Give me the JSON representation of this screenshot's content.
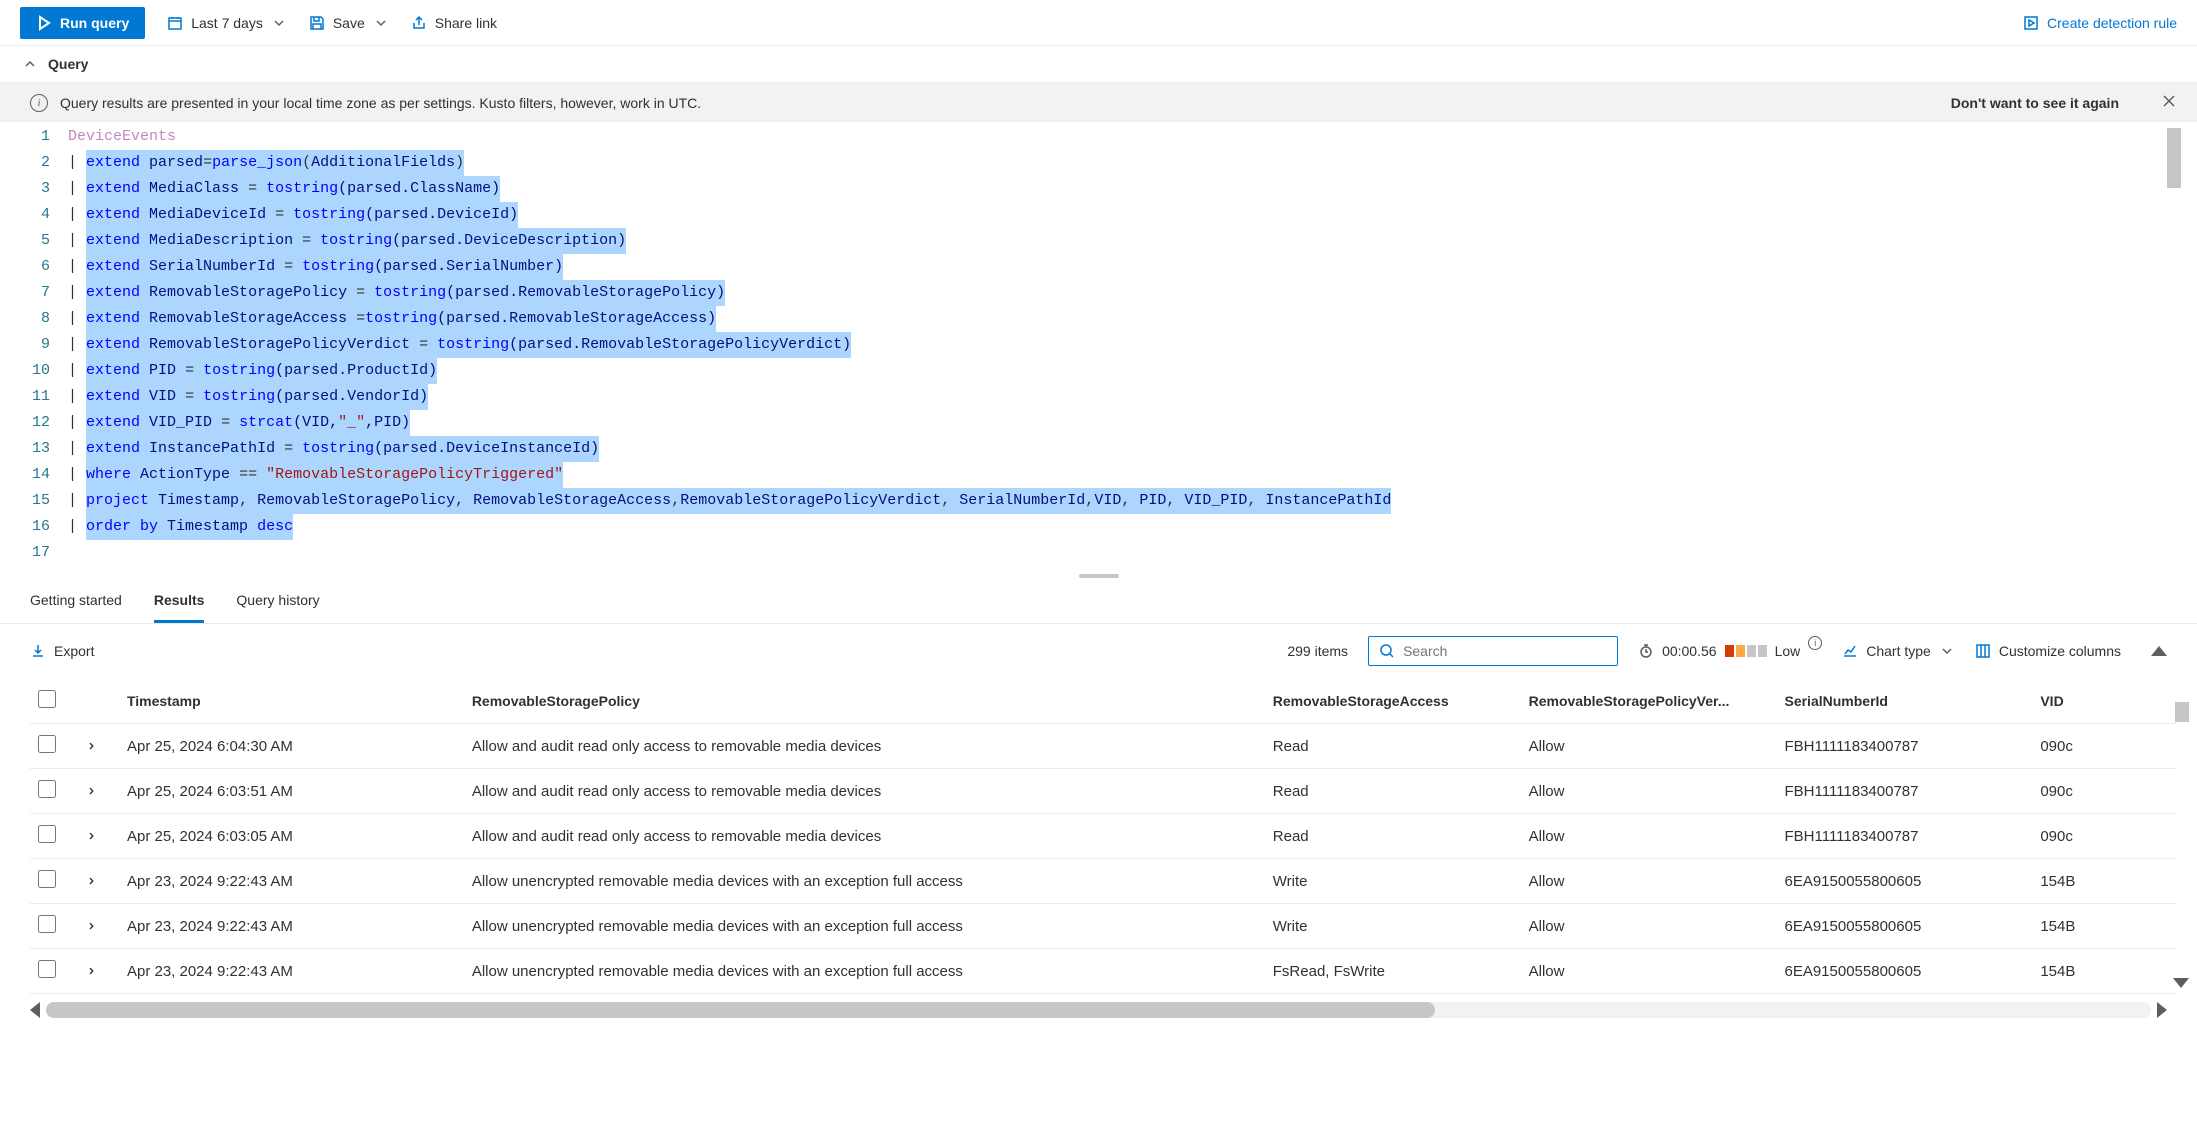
{
  "toolbar": {
    "run": "Run query",
    "timeRange": "Last 7 days",
    "save": "Save",
    "share": "Share link",
    "createRule": "Create detection rule"
  },
  "queryHeader": "Query",
  "banner": {
    "text": "Query results are presented in your local time zone as per settings. Kusto filters, however, work in UTC.",
    "dismiss": "Don't want to see it again"
  },
  "code": {
    "lineCount": 17,
    "lines": [
      [
        {
          "t": "DeviceEvents",
          "c": "tk-table"
        }
      ],
      [
        {
          "t": "| ",
          "c": "tk-pipe"
        },
        {
          "t": "extend ",
          "c": "tk-kw",
          "hl": true
        },
        {
          "t": "parsed",
          "c": "tk-col",
          "hl": true
        },
        {
          "t": "=",
          "c": "tk-op",
          "hl": true
        },
        {
          "t": "parse_json",
          "c": "tk-fn",
          "hl": true
        },
        {
          "t": "(",
          "c": "tk-op",
          "hl": true
        },
        {
          "t": "AdditionalFields",
          "c": "tk-col",
          "hl": true
        },
        {
          "t": ")",
          "c": "tk-op",
          "hl": true
        }
      ],
      [
        {
          "t": "| ",
          "c": "tk-pipe"
        },
        {
          "t": "extend ",
          "c": "tk-kw",
          "hl": true
        },
        {
          "t": "MediaClass ",
          "c": "tk-col",
          "hl": true
        },
        {
          "t": "= ",
          "c": "tk-op",
          "hl": true
        },
        {
          "t": "tostring",
          "c": "tk-fn",
          "hl": true
        },
        {
          "t": "(parsed.ClassName)",
          "c": "tk-col",
          "hl": true
        }
      ],
      [
        {
          "t": "| ",
          "c": "tk-pipe"
        },
        {
          "t": "extend ",
          "c": "tk-kw",
          "hl": true
        },
        {
          "t": "MediaDeviceId ",
          "c": "tk-col",
          "hl": true
        },
        {
          "t": "= ",
          "c": "tk-op",
          "hl": true
        },
        {
          "t": "tostring",
          "c": "tk-fn",
          "hl": true
        },
        {
          "t": "(parsed.DeviceId)",
          "c": "tk-col",
          "hl": true
        }
      ],
      [
        {
          "t": "| ",
          "c": "tk-pipe"
        },
        {
          "t": "extend ",
          "c": "tk-kw",
          "hl": true
        },
        {
          "t": "MediaDescription ",
          "c": "tk-col",
          "hl": true
        },
        {
          "t": "= ",
          "c": "tk-op",
          "hl": true
        },
        {
          "t": "tostring",
          "c": "tk-fn",
          "hl": true
        },
        {
          "t": "(parsed.DeviceDescription)",
          "c": "tk-col",
          "hl": true
        }
      ],
      [
        {
          "t": "| ",
          "c": "tk-pipe"
        },
        {
          "t": "extend ",
          "c": "tk-kw",
          "hl": true
        },
        {
          "t": "SerialNumberId ",
          "c": "tk-col",
          "hl": true
        },
        {
          "t": "= ",
          "c": "tk-op",
          "hl": true
        },
        {
          "t": "tostring",
          "c": "tk-fn",
          "hl": true
        },
        {
          "t": "(parsed.SerialNumber)",
          "c": "tk-col",
          "hl": true
        }
      ],
      [
        {
          "t": "| ",
          "c": "tk-pipe"
        },
        {
          "t": "extend ",
          "c": "tk-kw",
          "hl": true
        },
        {
          "t": "RemovableStoragePolicy ",
          "c": "tk-col",
          "hl": true
        },
        {
          "t": "= ",
          "c": "tk-op",
          "hl": true
        },
        {
          "t": "tostring",
          "c": "tk-fn",
          "hl": true
        },
        {
          "t": "(parsed.RemovableStoragePolicy)",
          "c": "tk-col",
          "hl": true
        }
      ],
      [
        {
          "t": "| ",
          "c": "tk-pipe"
        },
        {
          "t": "extend ",
          "c": "tk-kw",
          "hl": true
        },
        {
          "t": "RemovableStorageAccess ",
          "c": "tk-col",
          "hl": true
        },
        {
          "t": "=",
          "c": "tk-op",
          "hl": true
        },
        {
          "t": "tostring",
          "c": "tk-fn",
          "hl": true
        },
        {
          "t": "(parsed.RemovableStorageAccess)",
          "c": "tk-col",
          "hl": true
        }
      ],
      [
        {
          "t": "| ",
          "c": "tk-pipe"
        },
        {
          "t": "extend ",
          "c": "tk-kw",
          "hl": true
        },
        {
          "t": "RemovableStoragePolicyVerdict ",
          "c": "tk-col",
          "hl": true
        },
        {
          "t": "= ",
          "c": "tk-op",
          "hl": true
        },
        {
          "t": "tostring",
          "c": "tk-fn",
          "hl": true
        },
        {
          "t": "(parsed.RemovableStoragePolicyVerdict)",
          "c": "tk-col",
          "hl": true
        }
      ],
      [
        {
          "t": "| ",
          "c": "tk-pipe"
        },
        {
          "t": "extend ",
          "c": "tk-kw",
          "hl": true
        },
        {
          "t": "PID ",
          "c": "tk-col",
          "hl": true
        },
        {
          "t": "= ",
          "c": "tk-op",
          "hl": true
        },
        {
          "t": "tostring",
          "c": "tk-fn",
          "hl": true
        },
        {
          "t": "(parsed.ProductId)",
          "c": "tk-col",
          "hl": true
        }
      ],
      [
        {
          "t": "| ",
          "c": "tk-pipe"
        },
        {
          "t": "extend ",
          "c": "tk-kw",
          "hl": true
        },
        {
          "t": "VID ",
          "c": "tk-col",
          "hl": true
        },
        {
          "t": "= ",
          "c": "tk-op",
          "hl": true
        },
        {
          "t": "tostring",
          "c": "tk-fn",
          "hl": true
        },
        {
          "t": "(parsed.VendorId)",
          "c": "tk-col",
          "hl": true
        }
      ],
      [
        {
          "t": "| ",
          "c": "tk-pipe"
        },
        {
          "t": "extend ",
          "c": "tk-kw",
          "hl": true
        },
        {
          "t": "VID_PID ",
          "c": "tk-col",
          "hl": true
        },
        {
          "t": "= ",
          "c": "tk-op",
          "hl": true
        },
        {
          "t": "strcat",
          "c": "tk-fn",
          "hl": true
        },
        {
          "t": "(VID,",
          "c": "tk-col",
          "hl": true
        },
        {
          "t": "\"_\"",
          "c": "tk-str",
          "hl": true
        },
        {
          "t": ",PID)",
          "c": "tk-col",
          "hl": true
        }
      ],
      [
        {
          "t": "| ",
          "c": "tk-pipe"
        },
        {
          "t": "extend ",
          "c": "tk-kw",
          "hl": true
        },
        {
          "t": "InstancePathId ",
          "c": "tk-col",
          "hl": true
        },
        {
          "t": "= ",
          "c": "tk-op",
          "hl": true
        },
        {
          "t": "tostring",
          "c": "tk-fn",
          "hl": true
        },
        {
          "t": "(parsed.DeviceInstanceId)",
          "c": "tk-col",
          "hl": true
        }
      ],
      [
        {
          "t": "| ",
          "c": "tk-pipe"
        },
        {
          "t": "where ",
          "c": "tk-kw",
          "hl": true
        },
        {
          "t": "ActionType ",
          "c": "tk-col",
          "hl": true
        },
        {
          "t": "== ",
          "c": "tk-op",
          "hl": true
        },
        {
          "t": "\"RemovableStoragePolicyTriggered\"",
          "c": "tk-str",
          "hl": true
        }
      ],
      [
        {
          "t": "| ",
          "c": "tk-pipe"
        },
        {
          "t": "project ",
          "c": "tk-kw",
          "hl": true
        },
        {
          "t": "Timestamp",
          "c": "tk-col",
          "hl": true
        },
        {
          "t": ", ",
          "c": "tk-op",
          "hl": true
        },
        {
          "t": "RemovableStoragePolicy",
          "c": "tk-col",
          "hl": true
        },
        {
          "t": ", ",
          "c": "tk-op",
          "hl": true
        },
        {
          "t": "RemovableStorageAccess",
          "c": "tk-col",
          "hl": true
        },
        {
          "t": ",",
          "c": "tk-op",
          "hl": true
        },
        {
          "t": "RemovableStoragePolicyVerdict",
          "c": "tk-col",
          "hl": true
        },
        {
          "t": ", ",
          "c": "tk-op",
          "hl": true
        },
        {
          "t": "SerialNumberId",
          "c": "tk-col",
          "hl": true
        },
        {
          "t": ",",
          "c": "tk-op",
          "hl": true
        },
        {
          "t": "VID",
          "c": "tk-col",
          "hl": true
        },
        {
          "t": ", ",
          "c": "tk-op",
          "hl": true
        },
        {
          "t": "PID",
          "c": "tk-col",
          "hl": true
        },
        {
          "t": ", ",
          "c": "tk-op",
          "hl": true
        },
        {
          "t": "VID_PID",
          "c": "tk-col",
          "hl": true
        },
        {
          "t": ", ",
          "c": "tk-op",
          "hl": true
        },
        {
          "t": "InstancePathId",
          "c": "tk-col",
          "hl": true
        }
      ],
      [
        {
          "t": "| ",
          "c": "tk-pipe"
        },
        {
          "t": "order by ",
          "c": "tk-kw",
          "hl": true
        },
        {
          "t": "Timestamp ",
          "c": "tk-col",
          "hl": true
        },
        {
          "t": "desc",
          "c": "tk-kw",
          "hl": true
        }
      ],
      []
    ]
  },
  "tabs": {
    "started": "Getting started",
    "results": "Results",
    "history": "Query history"
  },
  "results": {
    "export": "Export",
    "itemCount": "299 items",
    "searchPlaceholder": "Search",
    "timing": "00:00.56",
    "perfLabel": "Low",
    "chartType": "Chart type",
    "customize": "Customize columns",
    "columns": {
      "timestamp": "Timestamp",
      "policy": "RemovableStoragePolicy",
      "access": "RemovableStorageAccess",
      "verdict": "RemovableStoragePolicyVer...",
      "serial": "SerialNumberId",
      "vid": "VID"
    },
    "rows": [
      {
        "ts": "Apr 25, 2024 6:04:30 AM",
        "policy": "Allow and audit read only access to removable media devices",
        "access": "Read",
        "verdict": "Allow",
        "serial": "FBH1111183400787",
        "vid": "090c"
      },
      {
        "ts": "Apr 25, 2024 6:03:51 AM",
        "policy": "Allow and audit read only access to removable media devices",
        "access": "Read",
        "verdict": "Allow",
        "serial": "FBH1111183400787",
        "vid": "090c"
      },
      {
        "ts": "Apr 25, 2024 6:03:05 AM",
        "policy": "Allow and audit read only access to removable media devices",
        "access": "Read",
        "verdict": "Allow",
        "serial": "FBH1111183400787",
        "vid": "090c"
      },
      {
        "ts": "Apr 23, 2024 9:22:43 AM",
        "policy": "Allow unencrypted removable media devices with an exception full access",
        "access": "Write",
        "verdict": "Allow",
        "serial": "6EA9150055800605",
        "vid": "154B"
      },
      {
        "ts": "Apr 23, 2024 9:22:43 AM",
        "policy": "Allow unencrypted removable media devices with an exception full access",
        "access": "Write",
        "verdict": "Allow",
        "serial": "6EA9150055800605",
        "vid": "154B"
      },
      {
        "ts": "Apr 23, 2024 9:22:43 AM",
        "policy": "Allow unencrypted removable media devices with an exception full access",
        "access": "FsRead, FsWrite",
        "verdict": "Allow",
        "serial": "6EA9150055800605",
        "vid": "154B"
      }
    ]
  }
}
